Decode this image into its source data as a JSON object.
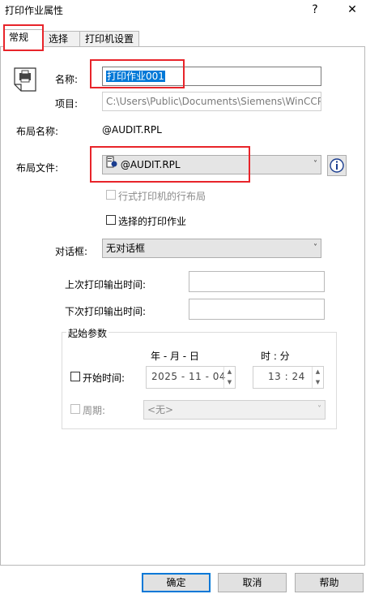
{
  "window": {
    "title": "打印作业属性",
    "help_glyph": "?",
    "close_glyph": "✕"
  },
  "tabs": [
    {
      "label": "常规"
    },
    {
      "label": "选择"
    },
    {
      "label": "打印机设置"
    }
  ],
  "general": {
    "name_label": "名称:",
    "name_value": "打印作业001",
    "project_label": "项目:",
    "project_value": "C:\\Users\\Public\\Documents\\Siemens\\WinCCProjects",
    "layout_name_label": "布局名称:",
    "layout_name_value": "@AUDIT.RPL",
    "layout_file_label": "布局文件:",
    "layout_file_value": "@AUDIT.RPL",
    "line_layout_label": "行式打印机的行布局",
    "selected_job_label": "选择的打印作业",
    "dialog_label": "对话框:",
    "dialog_value": "无对话框",
    "last_print_label": "上次打印输出时间:",
    "next_print_label": "下次打印输出时间:"
  },
  "start_params": {
    "group_title": "起始参数",
    "date_header": "年 - 月 - 日",
    "time_header": "时 : 分",
    "start_time_label": "开始时间:",
    "date_value": "2025 - 11 - 04",
    "time_value": "13 : 24",
    "period_label": "周期:",
    "period_value": "<无>"
  },
  "footer": {
    "ok_label": "确定",
    "cancel_label": "取消",
    "help_label": "帮助"
  },
  "colors": {
    "highlight_red": "#e8242a",
    "selection_blue": "#0078d7"
  }
}
